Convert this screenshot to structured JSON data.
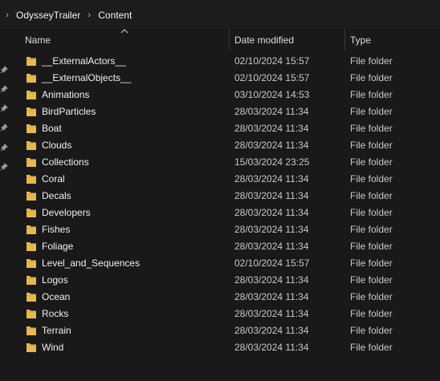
{
  "breadcrumb": {
    "items": [
      "OdysseyTrailer",
      "Content"
    ]
  },
  "columns": {
    "name": "Name",
    "date_modified": "Date modified",
    "type": "Type"
  },
  "sort": {
    "column": "name",
    "direction": "ascending"
  },
  "colors": {
    "background": "#191919",
    "folder": "#e8b94a",
    "text": "#f0f0f0",
    "muted_text": "#c8c8c8"
  },
  "files": [
    {
      "name": "__ExternalActors__",
      "date": "02/10/2024 15:57",
      "type": "File folder"
    },
    {
      "name": "__ExternalObjects__",
      "date": "02/10/2024 15:57",
      "type": "File folder"
    },
    {
      "name": "Animations",
      "date": "03/10/2024 14:53",
      "type": "File folder"
    },
    {
      "name": "BirdParticles",
      "date": "28/03/2024 11:34",
      "type": "File folder"
    },
    {
      "name": "Boat",
      "date": "28/03/2024 11:34",
      "type": "File folder"
    },
    {
      "name": "Clouds",
      "date": "28/03/2024 11:34",
      "type": "File folder"
    },
    {
      "name": "Collections",
      "date": "15/03/2024 23:25",
      "type": "File folder"
    },
    {
      "name": "Coral",
      "date": "28/03/2024 11:34",
      "type": "File folder"
    },
    {
      "name": "Decals",
      "date": "28/03/2024 11:34",
      "type": "File folder"
    },
    {
      "name": "Developers",
      "date": "28/03/2024 11:34",
      "type": "File folder"
    },
    {
      "name": "Fishes",
      "date": "28/03/2024 11:34",
      "type": "File folder"
    },
    {
      "name": "Foliage",
      "date": "28/03/2024 11:34",
      "type": "File folder"
    },
    {
      "name": "Level_and_Sequences",
      "date": "02/10/2024 15:57",
      "type": "File folder"
    },
    {
      "name": "Logos",
      "date": "28/03/2024 11:34",
      "type": "File folder"
    },
    {
      "name": "Ocean",
      "date": "28/03/2024 11:34",
      "type": "File folder"
    },
    {
      "name": "Rocks",
      "date": "28/03/2024 11:34",
      "type": "File folder"
    },
    {
      "name": "Terrain",
      "date": "28/03/2024 11:34",
      "type": "File folder"
    },
    {
      "name": "Wind",
      "date": "28/03/2024 11:34",
      "type": "File folder"
    }
  ]
}
